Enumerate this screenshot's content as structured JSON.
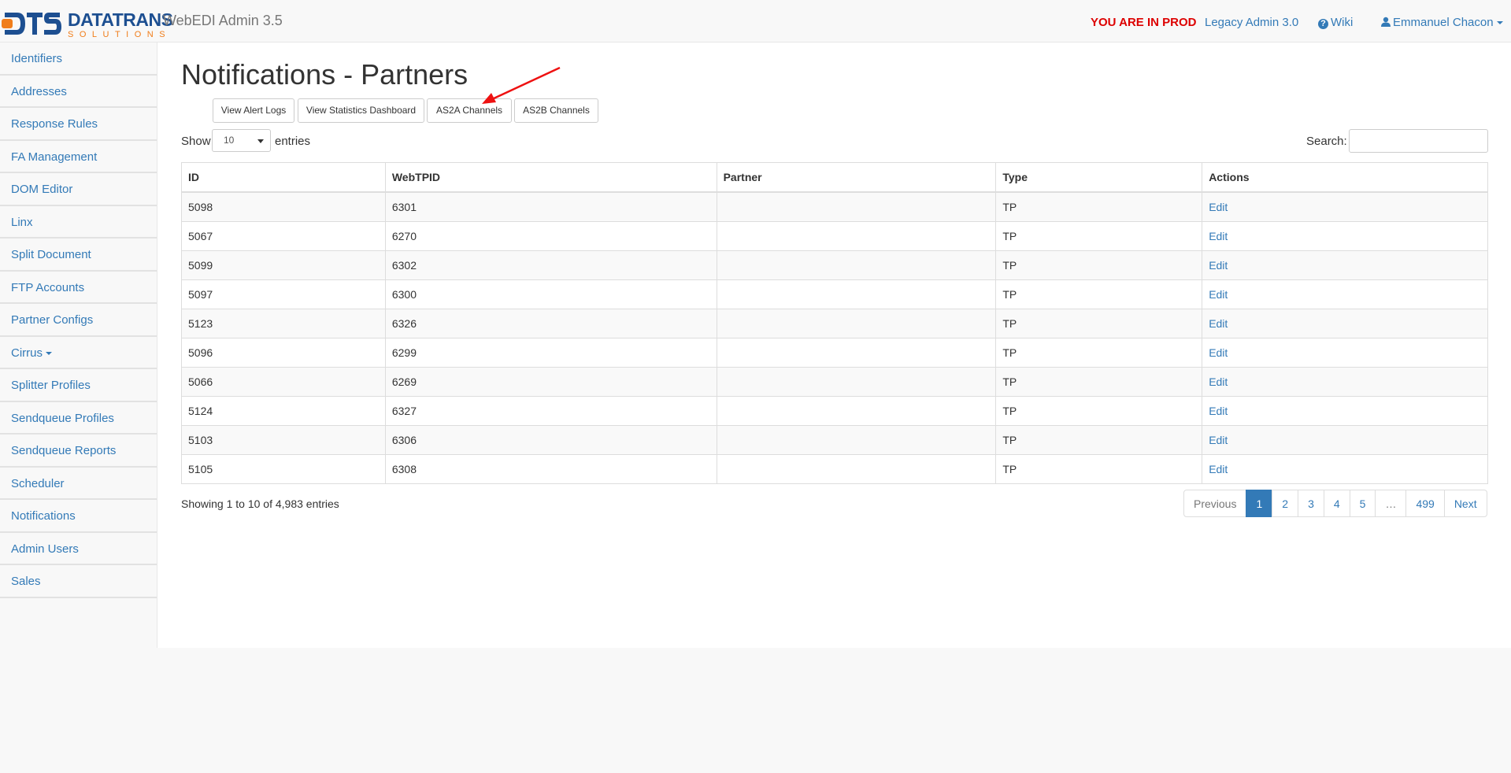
{
  "brand": {
    "logo_text": "DTS",
    "logo_brand": "DATATRANS",
    "logo_sub": "SOLUTIONS",
    "app_title": "WebEDI Admin 3.5"
  },
  "nav": {
    "prod_label": "YOU ARE IN PROD",
    "legacy_label": "Legacy Admin 3.0",
    "wiki_label": "Wiki",
    "user_label": "Emmanuel Chacon"
  },
  "sidebar": {
    "items": [
      {
        "label": "Identifiers"
      },
      {
        "label": "Addresses"
      },
      {
        "label": "Response Rules"
      },
      {
        "label": "FA Management"
      },
      {
        "label": "DOM Editor"
      },
      {
        "label": "Linx"
      },
      {
        "label": "Split Document"
      },
      {
        "label": "FTP Accounts"
      },
      {
        "label": "Partner Configs"
      },
      {
        "label": "Cirrus"
      },
      {
        "label": "Splitter Profiles"
      },
      {
        "label": "Sendqueue Profiles"
      },
      {
        "label": "Sendqueue Reports"
      },
      {
        "label": "Scheduler"
      },
      {
        "label": "Notifications"
      },
      {
        "label": "Admin Users"
      },
      {
        "label": "Sales"
      }
    ]
  },
  "main": {
    "title": "Notifications - Partners",
    "buttons": {
      "alert_logs": "View Alert Logs",
      "stats_dashboard": "View Statistics Dashboard",
      "as2a": "AS2A Channels",
      "as2b": "AS2B Channels"
    },
    "length": {
      "show": "Show",
      "value": "10",
      "entries": "entries"
    },
    "search_label": "Search:",
    "table": {
      "headers": [
        "ID",
        "WebTPID",
        "Partner",
        "Type",
        "Actions"
      ],
      "rows": [
        {
          "id": "5098",
          "webtpid": "6301",
          "partner": "",
          "type": "TP",
          "action": "Edit"
        },
        {
          "id": "5067",
          "webtpid": "6270",
          "partner": "",
          "type": "TP",
          "action": "Edit"
        },
        {
          "id": "5099",
          "webtpid": "6302",
          "partner": "",
          "type": "TP",
          "action": "Edit"
        },
        {
          "id": "5097",
          "webtpid": "6300",
          "partner": "",
          "type": "TP",
          "action": "Edit"
        },
        {
          "id": "5123",
          "webtpid": "6326",
          "partner": "",
          "type": "TP",
          "action": "Edit"
        },
        {
          "id": "5096",
          "webtpid": "6299",
          "partner": "",
          "type": "TP",
          "action": "Edit"
        },
        {
          "id": "5066",
          "webtpid": "6269",
          "partner": "",
          "type": "TP",
          "action": "Edit"
        },
        {
          "id": "5124",
          "webtpid": "6327",
          "partner": "",
          "type": "TP",
          "action": "Edit"
        },
        {
          "id": "5103",
          "webtpid": "6306",
          "partner": "",
          "type": "TP",
          "action": "Edit"
        },
        {
          "id": "5105",
          "webtpid": "6308",
          "partner": "",
          "type": "TP",
          "action": "Edit"
        }
      ]
    },
    "info": "Showing 1 to 10 of 4,983 entries",
    "pagination": {
      "previous": "Previous",
      "pages": [
        "1",
        "2",
        "3",
        "4",
        "5",
        "…",
        "499"
      ],
      "next": "Next",
      "active": "1"
    }
  },
  "colors": {
    "link": "#337ab7",
    "prod": "#dd0000",
    "arrow": "#ee1111",
    "brand_blue": "#1d4f91",
    "brand_orange": "#f07d1a"
  }
}
